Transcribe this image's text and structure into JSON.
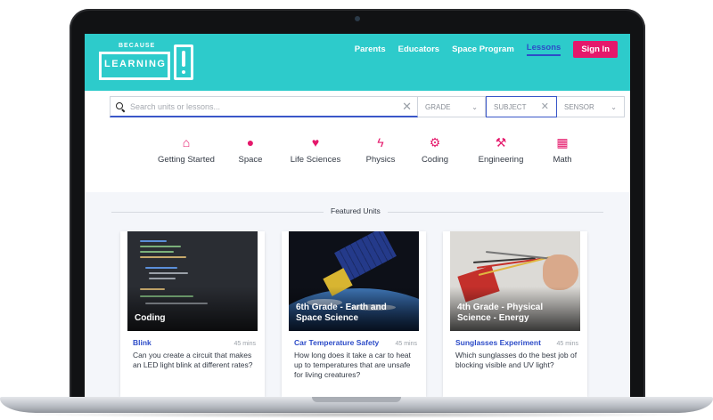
{
  "header": {
    "logo": {
      "top_text": "BECAUSE",
      "main_text": "LEARNING"
    },
    "nav": [
      {
        "label": "Parents",
        "active": false
      },
      {
        "label": "Educators",
        "active": false
      },
      {
        "label": "Space Program",
        "active": false
      },
      {
        "label": "Lessons",
        "active": true
      }
    ],
    "signin_label": "Sign In"
  },
  "search": {
    "placeholder": "Search units or lessons...",
    "filters": [
      {
        "label": "GRADE",
        "state": "collapsed"
      },
      {
        "label": "SUBJECT",
        "state": "focused"
      },
      {
        "label": "SENSOR",
        "state": "collapsed"
      }
    ]
  },
  "subjects": [
    {
      "label": "Getting Started",
      "icon": "home-icon",
      "glyph": "⌂"
    },
    {
      "label": "Space",
      "icon": "globe-icon",
      "glyph": "●"
    },
    {
      "label": "Life Sciences",
      "icon": "heartbeat-icon",
      "glyph": "♥"
    },
    {
      "label": "Physics",
      "icon": "lightning-icon",
      "glyph": "ϟ"
    },
    {
      "label": "Coding",
      "icon": "gears-icon",
      "glyph": "⚙"
    },
    {
      "label": "Engineering",
      "icon": "gavel-icon",
      "glyph": "⚒"
    },
    {
      "label": "Math",
      "icon": "grid-icon",
      "glyph": "▦"
    }
  ],
  "featured": {
    "title": "Featured Units",
    "cards": [
      {
        "caption": "Coding",
        "lesson_title": "Blink",
        "duration": "45 mins",
        "description": "Can you create a circuit that makes an LED light blink at different rates?"
      },
      {
        "caption": "6th Grade - Earth and Space Science",
        "lesson_title": "Car Temperature Safety",
        "duration": "45 mins",
        "description": "How long does it take a car to heat up to temperatures that are unsafe for living creatures?"
      },
      {
        "caption": "4th Grade - Physical Science - Energy",
        "lesson_title": "Sunglasses Experiment",
        "duration": "45 mins",
        "description": "Which sunglasses do the best job of blocking visible and UV light?"
      }
    ]
  },
  "colors": {
    "header_bg": "#2dcbcb",
    "accent_pink": "#e5186b",
    "accent_blue": "#2d4cc8"
  }
}
